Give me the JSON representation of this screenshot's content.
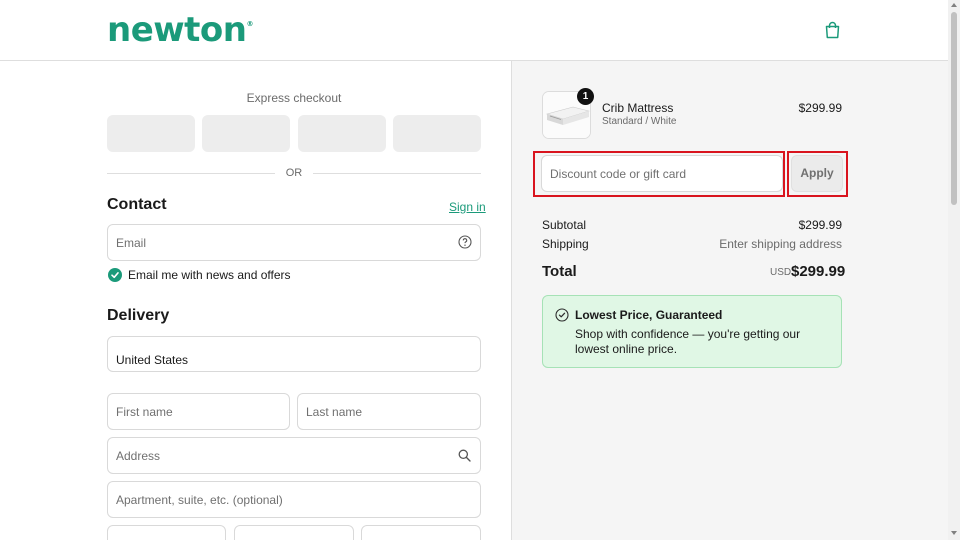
{
  "brand": {
    "name": "newton",
    "trademark": "®",
    "color": "#1b9a7a"
  },
  "header": {
    "cart_icon": "shopping-bag-icon"
  },
  "express": {
    "title": "Express checkout",
    "buttons": [
      "",
      "",
      "",
      ""
    ]
  },
  "divider": {
    "label": "OR"
  },
  "contact": {
    "heading": "Contact",
    "sign_in": "Sign in",
    "email_placeholder": "Email",
    "help_icon": "question-circle-icon",
    "marketing_label": "Email me with news and offers",
    "marketing_checked": true
  },
  "delivery": {
    "heading": "Delivery",
    "country": "United States",
    "first_name_placeholder": "First name",
    "last_name_placeholder": "Last name",
    "address_placeholder": "Address",
    "address_icon": "search-icon",
    "apartment_placeholder": "Apartment, suite, etc. (optional)"
  },
  "order": {
    "item": {
      "name": "Crib Mattress",
      "variant": "Standard / White",
      "price": "$299.99",
      "quantity": "1"
    },
    "discount_placeholder": "Discount code or gift card",
    "apply_label": "Apply",
    "subtotal_label": "Subtotal",
    "subtotal_value": "$299.99",
    "shipping_label": "Shipping",
    "shipping_value": "Enter shipping address",
    "total_label": "Total",
    "currency": "USD",
    "total_value": "$299.99"
  },
  "promo": {
    "icon": "check-circle-icon",
    "title": "Lowest Price, Guaranteed",
    "body": "Shop with confidence — you're getting our lowest online price."
  },
  "colors": {
    "accent": "#1b9a7a",
    "highlight_border": "#d9141e",
    "promo_bg": "#e0f7e5"
  }
}
